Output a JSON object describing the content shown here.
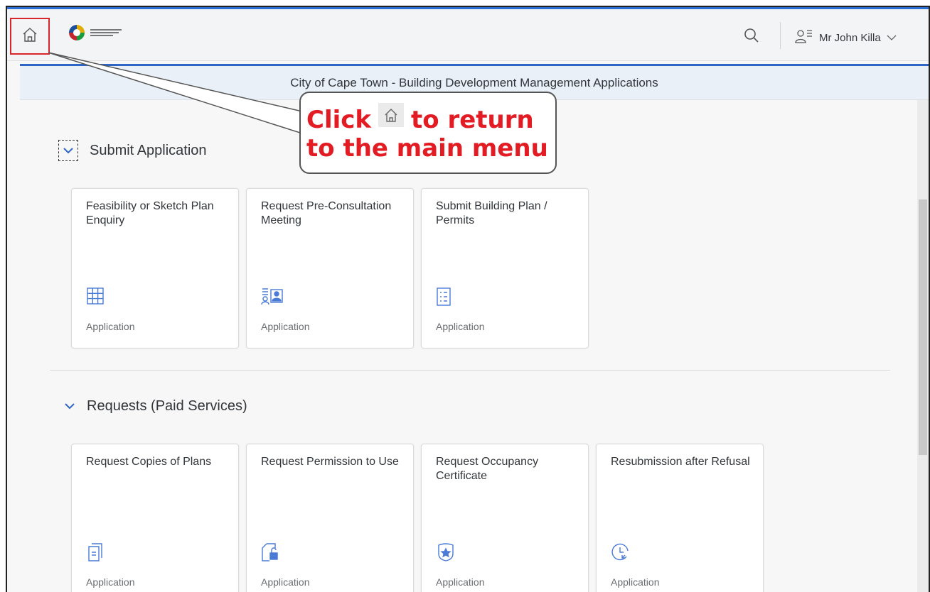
{
  "shell": {
    "user_name": "Mr John Killa",
    "page_title": "City of Cape Town - Building Development Management Applications",
    "logo_alt": "City of Cape Town"
  },
  "callout": {
    "line1_before": "Click",
    "line1_after": "to return",
    "line2": "to the main menu"
  },
  "sections": {
    "submit": {
      "title": "Submit Application",
      "tiles": [
        {
          "title": "Feasibility or Sketch Plan Enquiry",
          "footer": "Application",
          "icon": "grid-icon"
        },
        {
          "title": "Request Pre-Consultation Meeting",
          "footer": "Application",
          "icon": "contact-card-icon"
        },
        {
          "title": "Submit Building Plan / Permits",
          "footer": "Application",
          "icon": "checklist-icon"
        }
      ]
    },
    "requests": {
      "title": "Requests (Paid Services)",
      "tiles": [
        {
          "title": "Request Copies of Plans",
          "footer": "Application",
          "icon": "copy-document-icon"
        },
        {
          "title": "Request Permission to Use",
          "footer": "Application",
          "icon": "unlock-document-icon"
        },
        {
          "title": "Request Occupancy Certificate",
          "footer": "Application",
          "icon": "badge-icon"
        },
        {
          "title": "Resubmission after Refusal",
          "footer": "Application",
          "icon": "history-icon"
        }
      ]
    }
  },
  "colors": {
    "accent": "#2f66c5",
    "callout_text": "#e31b23",
    "highlight_box": "#d9252c",
    "icon": "#4a7bd6"
  }
}
